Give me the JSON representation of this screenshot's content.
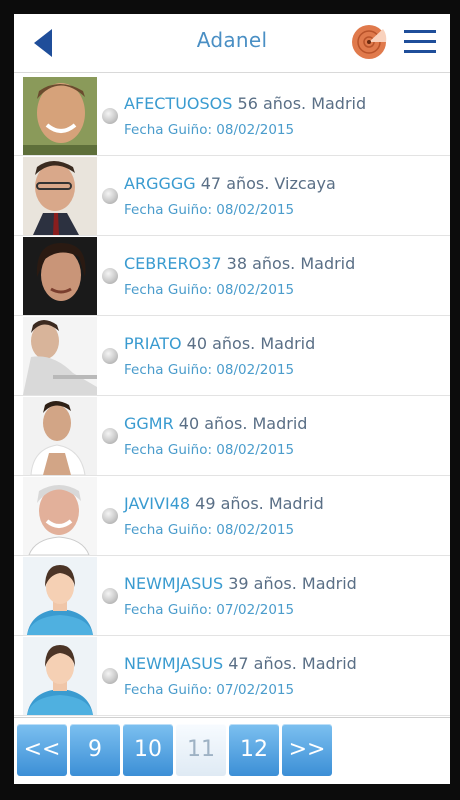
{
  "header": {
    "title": "Adanel"
  },
  "users": [
    {
      "nick": "AFECTUOSOS",
      "info": " 56 años. Madrid",
      "date_label": "Fecha Guiño: 08/02/2015"
    },
    {
      "nick": "ARGGGG",
      "info": " 47 años. Vizcaya",
      "date_label": "Fecha Guiño: 08/02/2015"
    },
    {
      "nick": "CEBRERO37",
      "info": " 38 años. Madrid",
      "date_label": "Fecha Guiño: 08/02/2015"
    },
    {
      "nick": "PRIATO",
      "info": " 40 años. Madrid",
      "date_label": "Fecha Guiño: 08/02/2015"
    },
    {
      "nick": "GGMR",
      "info": " 40 años. Madrid",
      "date_label": "Fecha Guiño: 08/02/2015"
    },
    {
      "nick": "JAVIVI48",
      "info": " 49 años. Madrid",
      "date_label": "Fecha Guiño: 08/02/2015"
    },
    {
      "nick": "NEWMJASUS",
      "info": "  39 años. Madrid",
      "date_label": "Fecha Guiño: 07/02/2015"
    },
    {
      "nick": "NEWMJASUS",
      "info": "  47 años. Madrid",
      "date_label": "Fecha Guiño: 07/02/2015"
    }
  ],
  "pagination": {
    "buttons": [
      "<<",
      "9",
      "10",
      "11",
      "12",
      ">>"
    ],
    "current": "11"
  },
  "colors": {
    "accent": "#3a9bd0",
    "header_title": "#4a8fc4",
    "icons": "#1f4e9a",
    "radar": "#e07a4c"
  }
}
